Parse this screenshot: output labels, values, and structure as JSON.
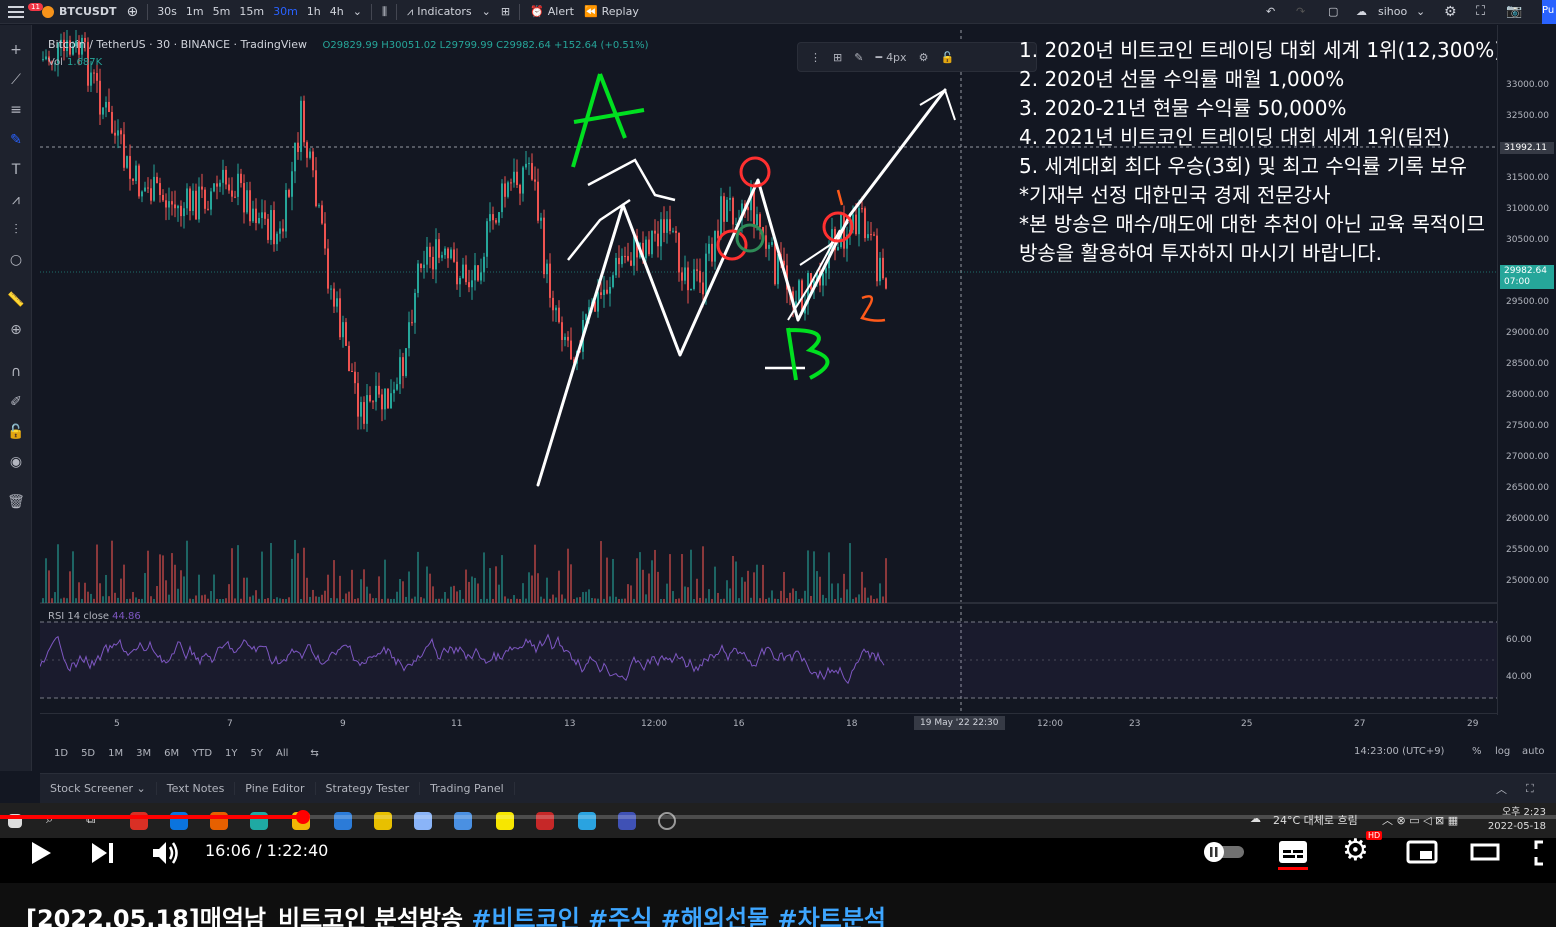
{
  "topbar": {
    "notif_count": "11",
    "symbol": "BTCUSDT",
    "timeframes": [
      "30s",
      "1m",
      "5m",
      "15m",
      "30m",
      "1h",
      "4h"
    ],
    "active_timeframe": "30m",
    "indicators": "Indicators",
    "alert": "Alert",
    "replay": "Replay",
    "user": "sihoo",
    "publish": "Pu"
  },
  "legend": {
    "title": "Bitcoin / TetherUS · 30 · BINANCE · TradingView",
    "ohlc": "O29829.99 H30051.02 L29799.99 C29982.64 +152.64 (+0.51%)",
    "vol_label": "Vol",
    "vol_value": "1.687K",
    "rsi_label": "RSI 14 close",
    "rsi_value": "44.86"
  },
  "draw_toolbar": {
    "width_label": "4px"
  },
  "price_axis": {
    "labels": [
      "33000.00",
      "32500.00",
      "31500.00",
      "31000.00",
      "30500.00",
      "29500.00",
      "29000.00",
      "28500.00",
      "28000.00",
      "27500.00",
      "27000.00",
      "26500.00",
      "26000.00",
      "25500.00",
      "25000.00",
      "60.00",
      "40.00"
    ],
    "crosshair_price": "31992.11",
    "current_price": "29982.64",
    "current_countdown": "07:00"
  },
  "time_axis": {
    "labels": [
      "5",
      "7",
      "9",
      "11",
      "13",
      "12:00",
      "16",
      "18",
      "12:00",
      "23",
      "25",
      "27",
      "29"
    ],
    "crosshair_time": "19 May '22  22:30"
  },
  "range_bar": {
    "ranges": [
      "1D",
      "5D",
      "1M",
      "3M",
      "6M",
      "YTD",
      "1Y",
      "5Y",
      "All"
    ],
    "clock": "14:23:00 (UTC+9)",
    "pct": "%",
    "log": "log",
    "auto": "auto"
  },
  "bottom_panel": [
    "Stock Screener",
    "Text Notes",
    "Pine Editor",
    "Strategy Tester",
    "Trading Panel"
  ],
  "overlay_lines": [
    "1. 2020년 비트코인 트레이딩 대회 세계 1위(12,300%)",
    "2. 2020년 선물 수익률 매월 1,000%",
    "3. 2020-21년 현물 수익률 50,000%",
    "4. 2021년 비트코인 트레이딩 대회 세계 1위(팀전)",
    "5. 세계대회 최다 우승(3회) 및 최고 수익률 기록 보유",
    "*기재부 선정 대한민국 경제 전문강사",
    "*본 방송은 매수/매도에 대한 추천이 아닌 교육 목적이므",
    " 방송을 활용하여 투자하지 마시기 바랍니다."
  ],
  "annotations": {
    "a": "A",
    "b": "B",
    "n1": "1",
    "n2": "2"
  },
  "taskbar": {
    "weather": "24°C 대체로 흐림",
    "time": "오후 2:23",
    "date": "2022-05-18"
  },
  "player": {
    "time": "16:06 / 1:22:40",
    "progress": 0.195,
    "hd": "HD"
  },
  "video_title": {
    "text": "[2022.05.18]매억남_비트코인 분석방송 ",
    "tags": "#비트코인 #주식 #해외선물 #차트분석"
  },
  "colors": {
    "up": "#26a69a",
    "down": "#ef5350",
    "rsi": "#7e57c2",
    "accent": "#2962ff",
    "progress": "#ff0000",
    "marker_green": "#00e020",
    "marker_red": "#ff3030"
  }
}
